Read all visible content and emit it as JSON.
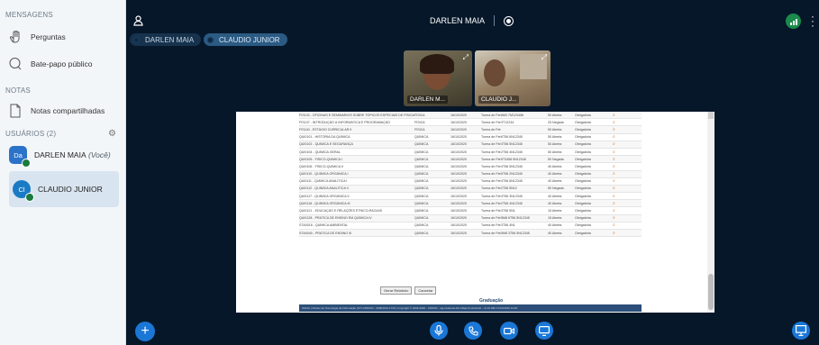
{
  "sidebar": {
    "messages_title": "MENSAGENS",
    "items": [
      {
        "label": "Perguntas",
        "icon": "hand-icon"
      },
      {
        "label": "Bate-papo público",
        "icon": "chat-bubble-icon"
      }
    ],
    "notes_title": "NOTAS",
    "notes_item": {
      "label": "Notas compartilhadas",
      "icon": "document-icon"
    },
    "users_title": "USUÁRIOS (2)",
    "users": [
      {
        "initials": "Da",
        "name": "DARLEN MAIA",
        "you": "(Você)",
        "color": "#2b73c9"
      },
      {
        "initials": "Cl",
        "name": "CLAUDIO JUNIOR",
        "color": "#1b7ac4"
      }
    ]
  },
  "topbar": {
    "title": "DARLEN MAIA",
    "chips": [
      "DARLEN MAIA",
      "CLAUDIO JUNIOR"
    ]
  },
  "video": {
    "tiles": [
      {
        "name": "DARLEN M..."
      },
      {
        "name": "CLAUDIO J..."
      }
    ]
  },
  "slide": {
    "rows": [
      [
        "FIS133 - OFICINAS E SEMINÁRIOS SOBRE TÓPICOS ESPECIAIS DE FÍSICA",
        "FÍSICA",
        "16/10/2020",
        "Turma de Férias",
        "6M3 7M123456",
        "50 Aberta",
        "Obrigatória"
      ],
      [
        "FIS137 - INTRODUÇÃO À INFORMÁTICA E PROGRAMAÇÃO",
        "FÍSICA",
        "16/10/2020",
        "Turma de Férias",
        "3T12234",
        "25 Negada",
        "Obrigatória"
      ],
      [
        "FIS140 - ESTÁGIO CURRICULAR II",
        "FÍSICA",
        "16/10/2020",
        "Turma de Férias",
        "",
        "50 Aberta",
        "Obrigatória"
      ],
      [
        "QUI0101 - HISTÓRIA DA QUÍMICA",
        "QUÍMICA",
        "16/10/2020",
        "Turma de Férias",
        "6T56 6N12345",
        "50 Aberta",
        "Obrigatória"
      ],
      [
        "QUI0102 - QUÍMICA E SEGURANÇA",
        "QUÍMICA",
        "16/10/2020",
        "Turma de Férias",
        "3T56 5N12345",
        "50 Aberta",
        "Obrigatória"
      ],
      [
        "QUI0104 - QUÍMICA GERAL",
        "QUÍMICA",
        "16/10/2020",
        "Turma de Férias",
        "2T56 4N12345",
        "50 Aberta",
        "Obrigatória"
      ],
      [
        "QUI0105 - FÍSICO-QUÍMICA I",
        "QUÍMICA",
        "16/10/2020",
        "Turma de Férias",
        "5T3456 5N12345",
        "50 Negada",
        "Obrigatória"
      ],
      [
        "QUI0106 - FÍSICO-QUÍMICA II",
        "QUÍMICA",
        "16/10/2020",
        "Turma de Férias",
        "4T56 5N12345",
        "40 Aberta",
        "Obrigatória"
      ],
      [
        "QUI0110 - QUÍMICA ORGÂNICA I",
        "QUÍMICA",
        "16/10/2020",
        "Turma de Férias",
        "6T56 2N12345",
        "40 Aberta",
        "Obrigatória"
      ],
      [
        "QUI0111 - QUÍMICA ANALÍTICA I",
        "QUÍMICA",
        "16/10/2020",
        "Turma de Férias",
        "4T56 6N12345",
        "40 Aberta",
        "Obrigatória"
      ],
      [
        "QUI0112 - QUÍMICA ANALÍTICA II",
        "QUÍMICA",
        "16/10/2020",
        "Turma de Férias",
        "2T56 5N12",
        "50 Negada",
        "Obrigatória"
      ],
      [
        "QUI0117 - QUÍMICA ORGÂNICA II",
        "QUÍMICA",
        "16/10/2020",
        "Turma de Férias",
        "4T56 3N12345",
        "40 Aberta",
        "Obrigatória"
      ],
      [
        "QUI0118 - QUÍMICA ORGÂNICA III",
        "QUÍMICA",
        "16/10/2020",
        "Turma de Férias",
        "2T56 4N12345",
        "40 Aberta",
        "Obrigatória"
      ],
      [
        "QUI0121 - EDUCAÇÃO E RELAÇÕES ÉTNICO-RACIAIS",
        "QUÍMICA",
        "16/10/2020",
        "Turma de Férias",
        "3T56 5N1",
        "15 Aberta",
        "Obrigatória"
      ],
      [
        "QUI0128 - PRÁTICA DE ENSINO EM QUÍMICA IV",
        "QUÍMICA",
        "16/10/2020",
        "Turma de Férias",
        "5M8 6T56 5N12345",
        "15 Aberta",
        "Obrigatória"
      ],
      [
        "STA0016 - QUÍMICA AMBIENTAL",
        "QUÍMICA",
        "16/10/2020",
        "Turma de Férias",
        "3T56 4N1",
        "40 Aberta",
        "Obrigatória"
      ],
      [
        "STA0040 - PRÁTICA DE ENSINO III",
        "QUÍMICA",
        "16/10/2020",
        "Turma de Férias",
        "5M8 3T56 5N12345",
        "40 Aberta",
        "Obrigatória"
      ]
    ],
    "btn_report": "Gerar Relatório",
    "btn_cancel": "Cancelar",
    "section_title": "Graduação",
    "footer": "SIGAA | Núcleo de Tecnologia da Informação (NTI-UNIFAP) - (096)3312-1733 | Copyright © 2006-2020 - UNIFAP - sig-instancia-02.unifap.br.sis1inst2 - v3.16.382 17/10/2020 14:46"
  },
  "controls": {
    "plus_icon": "plus-icon",
    "mic_icon": "microphone-icon",
    "phone_icon": "phone-icon",
    "camera_icon": "camera-icon",
    "screen_icon": "screen-share-icon",
    "presentation_icon": "presentation-icon"
  },
  "colors": {
    "background": "#06172a",
    "sidebar": "#f3f6f9",
    "accent": "#1a77d6",
    "stats_green": "#1b8a4b"
  }
}
